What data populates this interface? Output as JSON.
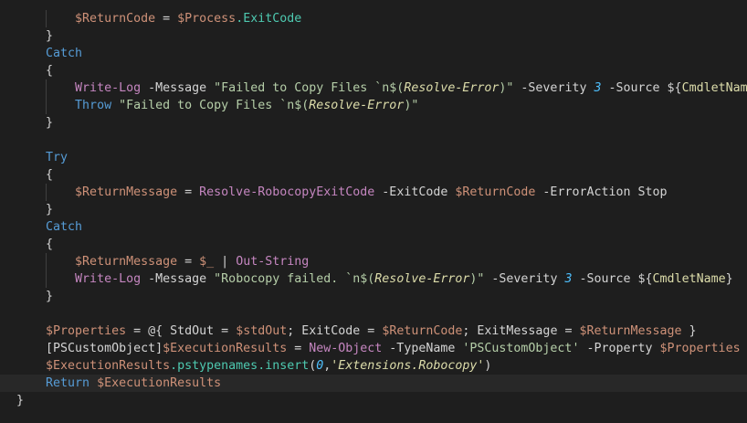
{
  "editor": {
    "lines": [
      [
        {
          "t": "        ",
          "c": ""
        },
        {
          "t": "$ReturnCode",
          "c": "tok-str"
        },
        {
          "t": " = ",
          "c": "tok-op"
        },
        {
          "t": "$Process",
          "c": "tok-str"
        },
        {
          "t": ".ExitCode",
          "c": "tok-prop"
        }
      ],
      [
        {
          "t": "    }",
          "c": "tok-op"
        }
      ],
      [
        {
          "t": "    Catch",
          "c": "tok-kw"
        }
      ],
      [
        {
          "t": "    {",
          "c": "tok-op"
        }
      ],
      [
        {
          "t": "        ",
          "c": ""
        },
        {
          "t": "Write-Log",
          "c": "tok-cmd"
        },
        {
          "t": " -Message ",
          "c": "tok-op"
        },
        {
          "t": "\"Failed to Copy Files `n$(",
          "c": "tok-str2"
        },
        {
          "t": "Resolve-Error",
          "c": "tok-it"
        },
        {
          "t": ")\"",
          "c": "tok-str2"
        },
        {
          "t": " -Severity ",
          "c": "tok-op"
        },
        {
          "t": "3",
          "c": "tok-num"
        },
        {
          "t": " -Source ",
          "c": "tok-op"
        },
        {
          "t": "${",
          "c": "tok-op"
        },
        {
          "t": "CmdletName",
          "c": "tok-ye"
        },
        {
          "t": "}",
          "c": "tok-op"
        }
      ],
      [
        {
          "t": "        ",
          "c": ""
        },
        {
          "t": "Throw",
          "c": "tok-kw"
        },
        {
          "t": " ",
          "c": ""
        },
        {
          "t": "\"Failed to Copy Files `n$(",
          "c": "tok-str2"
        },
        {
          "t": "Resolve-Error",
          "c": "tok-it"
        },
        {
          "t": ")\"",
          "c": "tok-str2"
        }
      ],
      [
        {
          "t": "    }",
          "c": "tok-op"
        }
      ],
      [
        {
          "t": "",
          "c": ""
        }
      ],
      [
        {
          "t": "    Try",
          "c": "tok-kw"
        }
      ],
      [
        {
          "t": "    {",
          "c": "tok-op"
        }
      ],
      [
        {
          "t": "        ",
          "c": ""
        },
        {
          "t": "$ReturnMessage",
          "c": "tok-str"
        },
        {
          "t": " = ",
          "c": "tok-op"
        },
        {
          "t": "Resolve-RobocopyExitCode",
          "c": "tok-cmd"
        },
        {
          "t": " -ExitCode ",
          "c": "tok-op"
        },
        {
          "t": "$ReturnCode",
          "c": "tok-str"
        },
        {
          "t": " -ErrorAction Stop",
          "c": "tok-op"
        }
      ],
      [
        {
          "t": "    }",
          "c": "tok-op"
        }
      ],
      [
        {
          "t": "    Catch",
          "c": "tok-kw"
        }
      ],
      [
        {
          "t": "    {",
          "c": "tok-op"
        }
      ],
      [
        {
          "t": "        ",
          "c": ""
        },
        {
          "t": "$ReturnMessage",
          "c": "tok-str"
        },
        {
          "t": " = ",
          "c": "tok-op"
        },
        {
          "t": "$_",
          "c": "tok-str"
        },
        {
          "t": " | ",
          "c": "tok-op"
        },
        {
          "t": "Out-String",
          "c": "tok-cmd"
        }
      ],
      [
        {
          "t": "        ",
          "c": ""
        },
        {
          "t": "Write-Log",
          "c": "tok-cmd"
        },
        {
          "t": " -Message ",
          "c": "tok-op"
        },
        {
          "t": "\"Robocopy failed. `n$(",
          "c": "tok-str2"
        },
        {
          "t": "Resolve-Error",
          "c": "tok-it"
        },
        {
          "t": ")\"",
          "c": "tok-str2"
        },
        {
          "t": " -Severity ",
          "c": "tok-op"
        },
        {
          "t": "3",
          "c": "tok-num"
        },
        {
          "t": " -Source ",
          "c": "tok-op"
        },
        {
          "t": "${",
          "c": "tok-op"
        },
        {
          "t": "CmdletName",
          "c": "tok-ye"
        },
        {
          "t": "}",
          "c": "tok-op"
        }
      ],
      [
        {
          "t": "    }",
          "c": "tok-op"
        }
      ],
      [
        {
          "t": "",
          "c": ""
        }
      ],
      [
        {
          "t": "    ",
          "c": ""
        },
        {
          "t": "$Properties",
          "c": "tok-str"
        },
        {
          "t": " = @{ StdOut = ",
          "c": "tok-op"
        },
        {
          "t": "$stdOut",
          "c": "tok-str"
        },
        {
          "t": "; ExitCode = ",
          "c": "tok-op"
        },
        {
          "t": "$ReturnCode",
          "c": "tok-str"
        },
        {
          "t": "; ExitMessage = ",
          "c": "tok-op"
        },
        {
          "t": "$ReturnMessage",
          "c": "tok-str"
        },
        {
          "t": " }",
          "c": "tok-op"
        }
      ],
      [
        {
          "t": "    [PSCustomObject]",
          "c": "tok-op"
        },
        {
          "t": "$ExecutionResults",
          "c": "tok-str"
        },
        {
          "t": " = ",
          "c": "tok-op"
        },
        {
          "t": "New-Object",
          "c": "tok-cmd"
        },
        {
          "t": " -TypeName ",
          "c": "tok-op"
        },
        {
          "t": "'PSCustomObject'",
          "c": "tok-str2"
        },
        {
          "t": " -Property ",
          "c": "tok-op"
        },
        {
          "t": "$Properties",
          "c": "tok-str"
        }
      ],
      [
        {
          "t": "    ",
          "c": ""
        },
        {
          "t": "$ExecutionResults",
          "c": "tok-str"
        },
        {
          "t": ".pstypenames.insert",
          "c": "tok-prop"
        },
        {
          "t": "(",
          "c": "tok-op"
        },
        {
          "t": "0",
          "c": "tok-num"
        },
        {
          "t": ",",
          "c": "tok-op"
        },
        {
          "t": "'Extensions.Robocopy'",
          "c": "tok-it"
        },
        {
          "t": ")",
          "c": "tok-op"
        }
      ],
      [
        {
          "t": "    ",
          "c": ""
        },
        {
          "t": "Return",
          "c": "tok-kw"
        },
        {
          "t": " ",
          "c": ""
        },
        {
          "t": "$ExecutionResults",
          "c": "tok-str"
        }
      ],
      [
        {
          "t": "}",
          "c": "tok-op"
        }
      ]
    ],
    "current_line": 21
  }
}
